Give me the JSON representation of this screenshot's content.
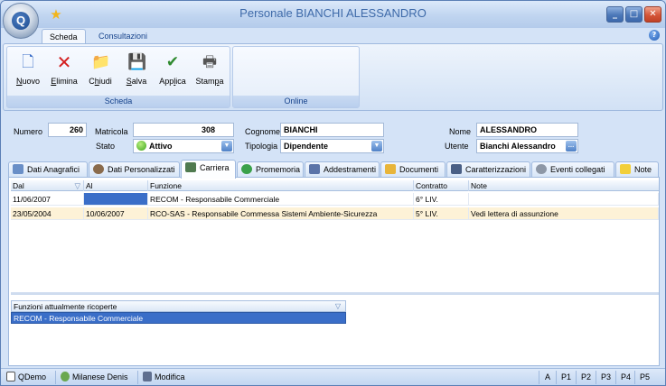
{
  "window": {
    "title": "Personale BIANCHI ALESSANDRO"
  },
  "app": {
    "orb_letter": "Q"
  },
  "ribbon": {
    "tabs": [
      "Scheda",
      "Consultazioni"
    ],
    "groups": {
      "scheda": "Scheda",
      "online": "Online"
    },
    "buttons": {
      "nuovo": {
        "mnemonic": "N",
        "rest": "uovo"
      },
      "elimina": {
        "mnemonic": "E",
        "rest": "limina"
      },
      "chiudi": {
        "mnemonic": "h",
        "pre": "C",
        "rest": "iudi"
      },
      "salva": {
        "mnemonic": "S",
        "rest": "alva"
      },
      "applica": {
        "mnemonic": "l",
        "pre": "App",
        "rest": "ica"
      },
      "stampa": {
        "mnemonic": "p",
        "pre": "Stam",
        "rest": "a"
      }
    }
  },
  "form": {
    "numero": {
      "label": "Numero",
      "value": "260"
    },
    "matricola": {
      "label": "Matricola",
      "value": "308"
    },
    "cognome": {
      "label": "Cognome",
      "value": "BIANCHI"
    },
    "nome": {
      "label": "Nome",
      "value": "ALESSANDRO"
    },
    "stato": {
      "label": "Stato",
      "value": "Attivo"
    },
    "tipologia": {
      "label": "Tipologia",
      "value": "Dipendente"
    },
    "utente": {
      "label": "Utente",
      "value": "Bianchi Alessandro"
    }
  },
  "tabs": [
    "Dati Anagrafici",
    "Dati Personalizzati",
    "Carriera",
    "Promemoria",
    "Addestramenti",
    "Documenti",
    "Caratterizzazioni",
    "Eventi collegati",
    "Note"
  ],
  "grid": {
    "columns": [
      "Dal",
      "Al",
      "Funzione",
      "Contratto",
      "Note"
    ],
    "rows": [
      {
        "dal": "11/06/2007",
        "al": "",
        "funzione": "RECOM - Responsabile Commerciale",
        "contratto": "6° LIV.",
        "note": ""
      },
      {
        "dal": "23/05/2004",
        "al": "10/06/2007",
        "funzione": "RCO-SAS - Responsabile Commessa Sistemi Ambiente-Sicurezza",
        "contratto": "5° LIV.",
        "note": "Vedi lettera di assunzione"
      }
    ]
  },
  "functions": {
    "header": "Funzioni attualmente ricoperte",
    "items": [
      "RECOM - Responsabile Commerciale"
    ]
  },
  "statusbar": {
    "db": "QDemo",
    "user": "Milanese Denis",
    "mode": "Modifica",
    "keys": [
      "A",
      "P1",
      "P2",
      "P3",
      "P4",
      "P5"
    ]
  },
  "colors": {
    "accent": "#3a6ec8",
    "alt_row": "#fdf2d7",
    "ribbon": "#dde9f8"
  }
}
